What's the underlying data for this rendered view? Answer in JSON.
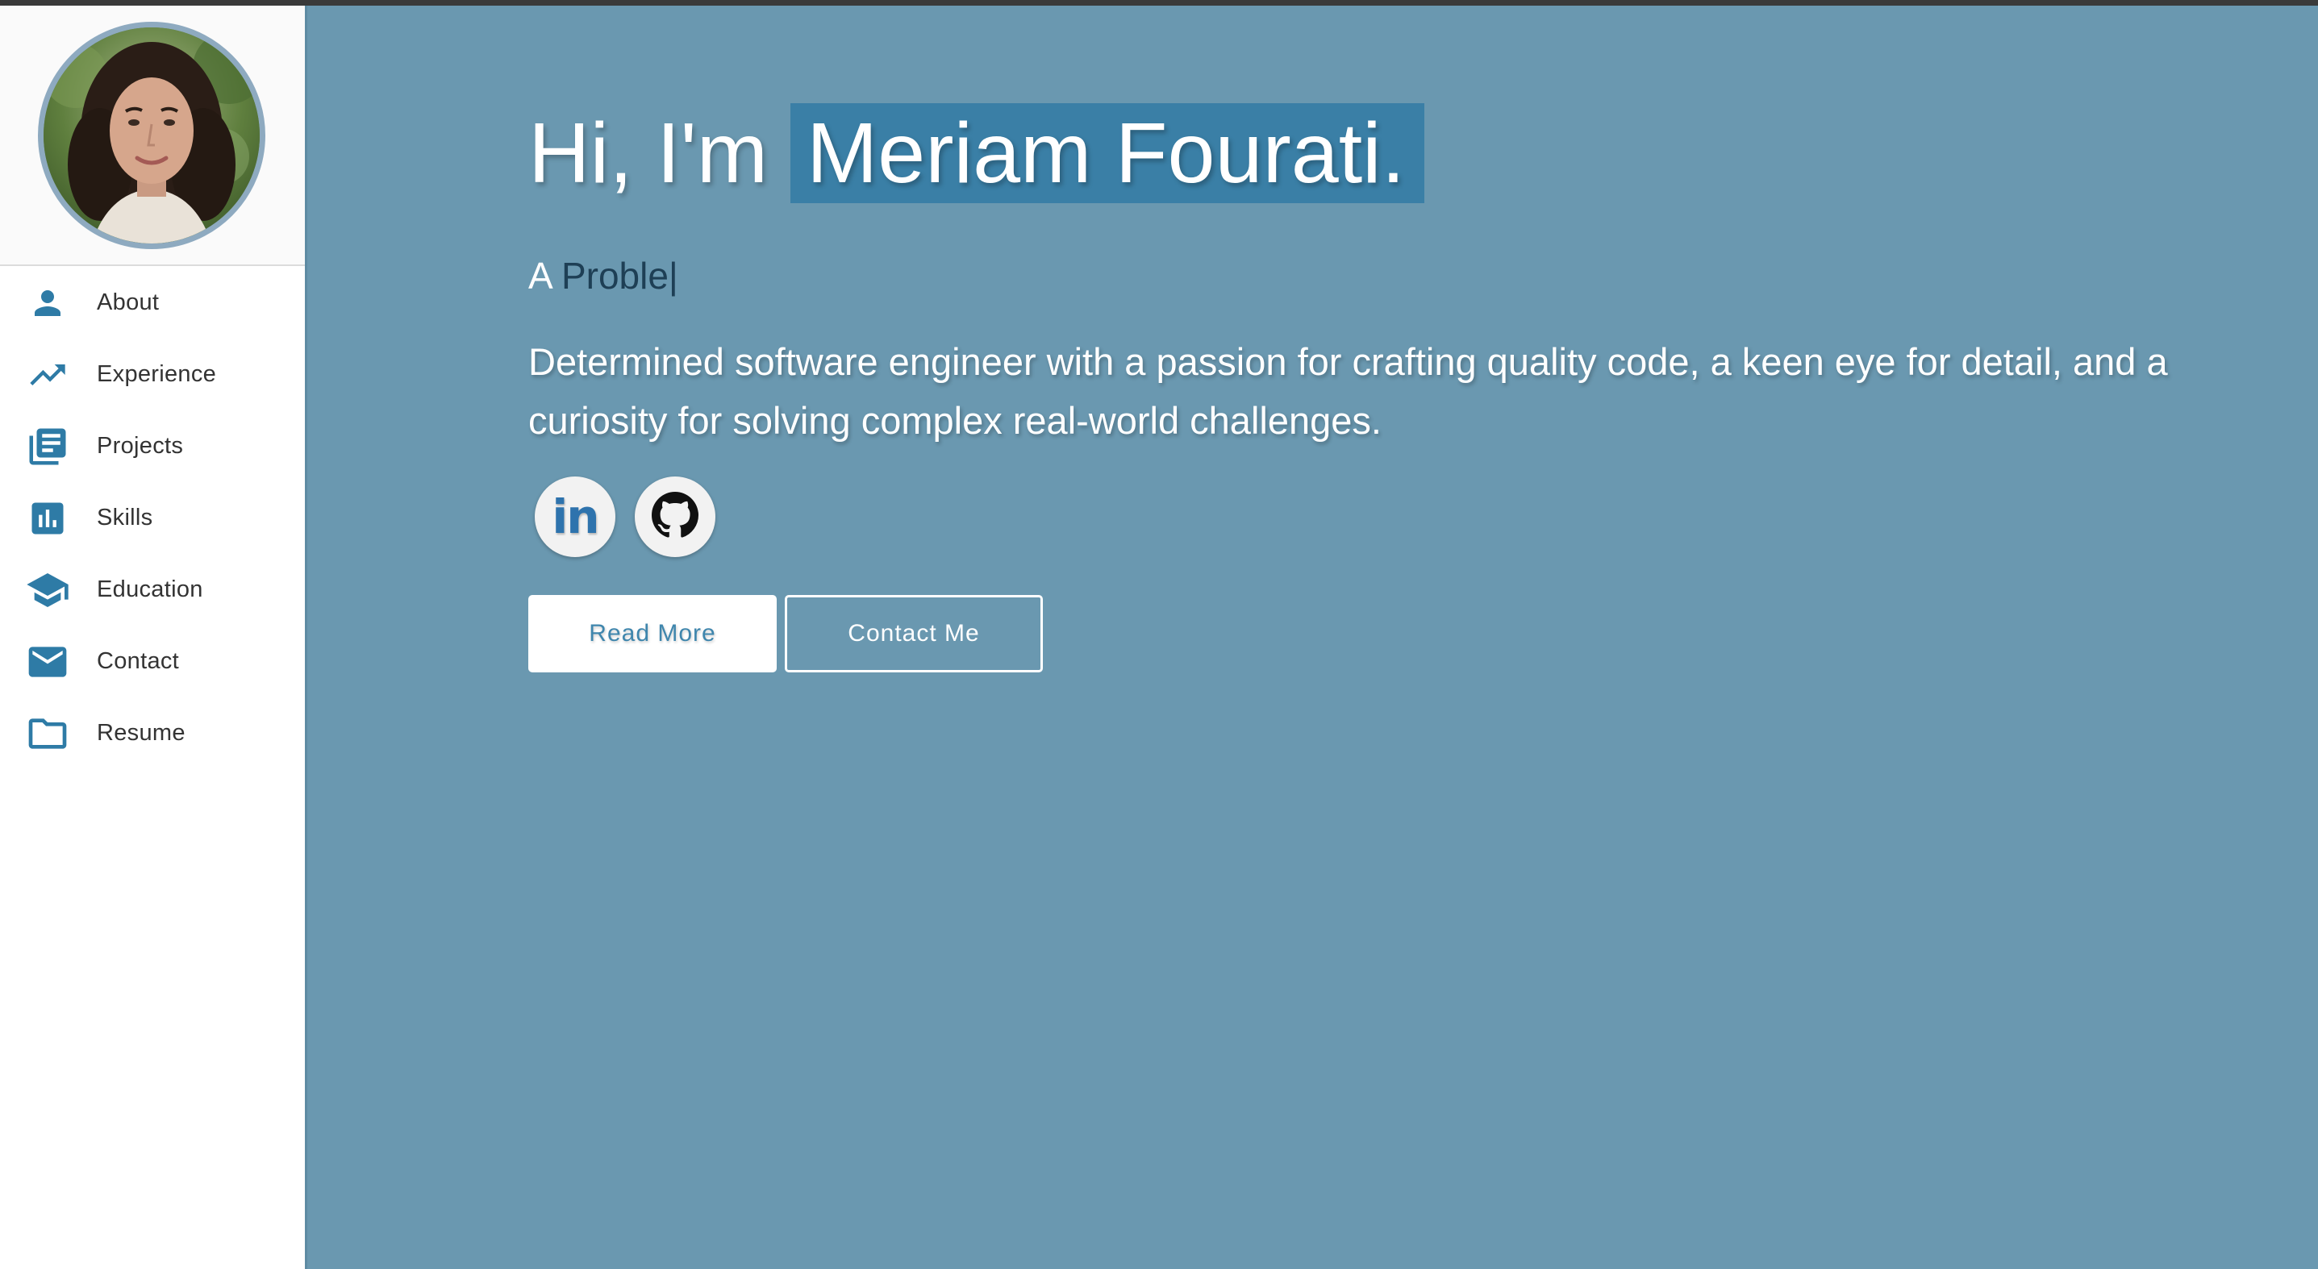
{
  "colors": {
    "accent": "#2e7ba6",
    "main_bg": "#6a98b0",
    "name_highlight": "#3a7fa6",
    "sidebar_bg": "#ffffff"
  },
  "sidebar": {
    "avatar_icon": "profile-photo",
    "items": [
      {
        "label": "About",
        "icon": "person-icon"
      },
      {
        "label": "Experience",
        "icon": "trending-up-icon"
      },
      {
        "label": "Projects",
        "icon": "library-books-icon"
      },
      {
        "label": "Skills",
        "icon": "bar-chart-icon"
      },
      {
        "label": "Education",
        "icon": "school-icon"
      },
      {
        "label": "Contact",
        "icon": "mail-icon"
      },
      {
        "label": "Resume",
        "icon": "folder-icon"
      }
    ]
  },
  "hero": {
    "greeting": "Hi, I'm",
    "name": "Meriam Fourati.",
    "typed_prefix": "A",
    "typed_word": "Proble",
    "typed_cursor": "|",
    "description": "Determined software engineer with a passion for crafting quality code, a keen eye for detail, and a curiosity for solving complex real-world challenges.",
    "social": [
      {
        "name": "linkedin",
        "icon": "linkedin-icon",
        "text": "in"
      },
      {
        "name": "github",
        "icon": "github-icon"
      }
    ],
    "read_more_label": "Read More",
    "contact_label": "Contact Me"
  }
}
